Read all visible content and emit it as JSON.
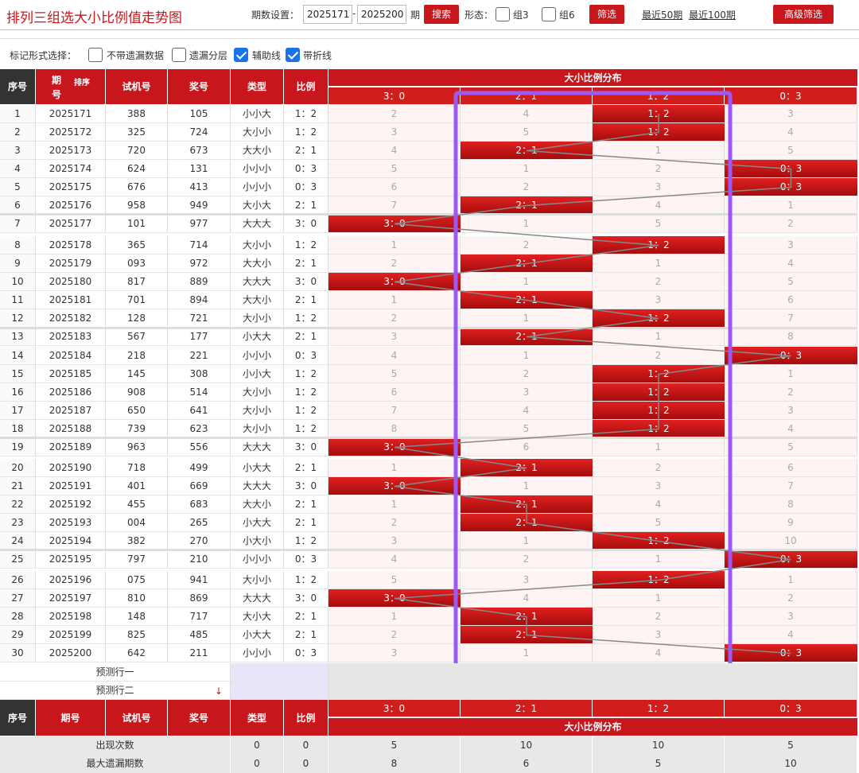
{
  "header": {
    "title": "排列三组选大小比例值走势图",
    "period_label": "期数设置：",
    "from": "2025171",
    "dash": "-",
    "to": "2025200",
    "qi": "期",
    "search": "搜索",
    "form_label": "形态：",
    "zu3": "组3",
    "zu6": "组6",
    "filter": "筛选",
    "recent50": "最近50期",
    "recent100": "最近100期",
    "advanced": "高级筛选"
  },
  "marks": {
    "label": "标记形式选择：",
    "opt1": "不带遗漏数据",
    "opt2": "遗漏分层",
    "opt3": "辅助线",
    "opt4": "带折线",
    "checked": [
      false,
      false,
      true,
      true
    ]
  },
  "columns": {
    "seq": "序号",
    "period_a": "期",
    "period_b": "号",
    "sort": "排序",
    "test": "试机号",
    "prize": "奖号",
    "type": "类型",
    "ratio": "比例",
    "dist": "大小比例分布",
    "period_full": "期号",
    "ratios": [
      "3：0",
      "2：1",
      "1：2",
      "0：3"
    ]
  },
  "rows": [
    {
      "s": "1",
      "p": "2025171",
      "t": "388",
      "a": "105",
      "ty": "小小大",
      "r": "1：2",
      "c": [
        2,
        4,
        null,
        3
      ]
    },
    {
      "s": "2",
      "p": "2025172",
      "t": "325",
      "a": "724",
      "ty": "大小小",
      "r": "1：2",
      "c": [
        3,
        5,
        null,
        4
      ]
    },
    {
      "s": "3",
      "p": "2025173",
      "t": "720",
      "a": "673",
      "ty": "大大小",
      "r": "2：1",
      "c": [
        4,
        null,
        1,
        5
      ]
    },
    {
      "s": "4",
      "p": "2025174",
      "t": "624",
      "a": "131",
      "ty": "小小小",
      "r": "0：3",
      "c": [
        5,
        1,
        2,
        null
      ]
    },
    {
      "s": "5",
      "p": "2025175",
      "t": "676",
      "a": "413",
      "ty": "小小小",
      "r": "0：3",
      "c": [
        6,
        2,
        3,
        null
      ]
    },
    {
      "s": "6",
      "p": "2025176",
      "t": "958",
      "a": "949",
      "ty": "大小大",
      "r": "2：1",
      "c": [
        7,
        null,
        4,
        1
      ]
    },
    {
      "s": "7",
      "p": "2025177",
      "t": "101",
      "a": "977",
      "ty": "大大大",
      "r": "3：0",
      "c": [
        null,
        1,
        5,
        2
      ]
    },
    {
      "s": "8",
      "p": "2025178",
      "t": "365",
      "a": "714",
      "ty": "大小小",
      "r": "1：2",
      "c": [
        1,
        2,
        null,
        3
      ]
    },
    {
      "s": "9",
      "p": "2025179",
      "t": "093",
      "a": "972",
      "ty": "大大小",
      "r": "2：1",
      "c": [
        2,
        null,
        1,
        4
      ]
    },
    {
      "s": "10",
      "p": "2025180",
      "t": "817",
      "a": "889",
      "ty": "大大大",
      "r": "3：0",
      "c": [
        null,
        1,
        2,
        5
      ]
    },
    {
      "s": "11",
      "p": "2025181",
      "t": "701",
      "a": "894",
      "ty": "大大小",
      "r": "2：1",
      "c": [
        1,
        null,
        3,
        6
      ]
    },
    {
      "s": "12",
      "p": "2025182",
      "t": "128",
      "a": "721",
      "ty": "大小小",
      "r": "1：2",
      "c": [
        2,
        1,
        null,
        7
      ]
    },
    {
      "s": "13",
      "p": "2025183",
      "t": "567",
      "a": "177",
      "ty": "小大大",
      "r": "2：1",
      "c": [
        3,
        null,
        1,
        8
      ]
    },
    {
      "s": "14",
      "p": "2025184",
      "t": "218",
      "a": "221",
      "ty": "小小小",
      "r": "0：3",
      "c": [
        4,
        1,
        2,
        null
      ]
    },
    {
      "s": "15",
      "p": "2025185",
      "t": "145",
      "a": "308",
      "ty": "小小大",
      "r": "1：2",
      "c": [
        5,
        2,
        null,
        1
      ]
    },
    {
      "s": "16",
      "p": "2025186",
      "t": "908",
      "a": "514",
      "ty": "大小小",
      "r": "1：2",
      "c": [
        6,
        3,
        null,
        2
      ]
    },
    {
      "s": "17",
      "p": "2025187",
      "t": "650",
      "a": "641",
      "ty": "大小小",
      "r": "1：2",
      "c": [
        7,
        4,
        null,
        3
      ]
    },
    {
      "s": "18",
      "p": "2025188",
      "t": "739",
      "a": "623",
      "ty": "大小小",
      "r": "1：2",
      "c": [
        8,
        5,
        null,
        4
      ]
    },
    {
      "s": "19",
      "p": "2025189",
      "t": "963",
      "a": "556",
      "ty": "大大大",
      "r": "3：0",
      "c": [
        null,
        6,
        1,
        5
      ]
    },
    {
      "s": "20",
      "p": "2025190",
      "t": "718",
      "a": "499",
      "ty": "小大大",
      "r": "2：1",
      "c": [
        1,
        null,
        2,
        6
      ]
    },
    {
      "s": "21",
      "p": "2025191",
      "t": "401",
      "a": "669",
      "ty": "大大大",
      "r": "3：0",
      "c": [
        null,
        1,
        3,
        7
      ]
    },
    {
      "s": "22",
      "p": "2025192",
      "t": "455",
      "a": "683",
      "ty": "大大小",
      "r": "2：1",
      "c": [
        1,
        null,
        4,
        8
      ]
    },
    {
      "s": "23",
      "p": "2025193",
      "t": "004",
      "a": "265",
      "ty": "小大大",
      "r": "2：1",
      "c": [
        2,
        null,
        5,
        9
      ]
    },
    {
      "s": "24",
      "p": "2025194",
      "t": "382",
      "a": "270",
      "ty": "小大小",
      "r": "1：2",
      "c": [
        3,
        1,
        null,
        10
      ]
    },
    {
      "s": "25",
      "p": "2025195",
      "t": "797",
      "a": "210",
      "ty": "小小小",
      "r": "0：3",
      "c": [
        4,
        2,
        1,
        null
      ]
    },
    {
      "s": "26",
      "p": "2025196",
      "t": "075",
      "a": "941",
      "ty": "大小小",
      "r": "1：2",
      "c": [
        5,
        3,
        null,
        1
      ]
    },
    {
      "s": "27",
      "p": "2025197",
      "t": "810",
      "a": "869",
      "ty": "大大大",
      "r": "3：0",
      "c": [
        null,
        4,
        1,
        2
      ]
    },
    {
      "s": "28",
      "p": "2025198",
      "t": "148",
      "a": "717",
      "ty": "大小大",
      "r": "2：1",
      "c": [
        1,
        null,
        2,
        3
      ]
    },
    {
      "s": "29",
      "p": "2025199",
      "t": "825",
      "a": "485",
      "ty": "小大大",
      "r": "2：1",
      "c": [
        2,
        null,
        3,
        4
      ]
    },
    {
      "s": "30",
      "p": "2025200",
      "t": "642",
      "a": "211",
      "ty": "小小小",
      "r": "0：3",
      "c": [
        3,
        1,
        4,
        null
      ]
    }
  ],
  "predict": [
    "预测行一",
    "预测行二"
  ],
  "stats": [
    {
      "label": "出现次数",
      "type": "0",
      "ratio": "0",
      "v": [
        "5",
        "10",
        "10",
        "5"
      ]
    },
    {
      "label": "最大遗漏期数",
      "type": "0",
      "ratio": "0",
      "v": [
        "8",
        "6",
        "5",
        "10"
      ]
    }
  ],
  "colors": {
    "accent": "#c8161d",
    "highlight": "#9b59f6"
  }
}
